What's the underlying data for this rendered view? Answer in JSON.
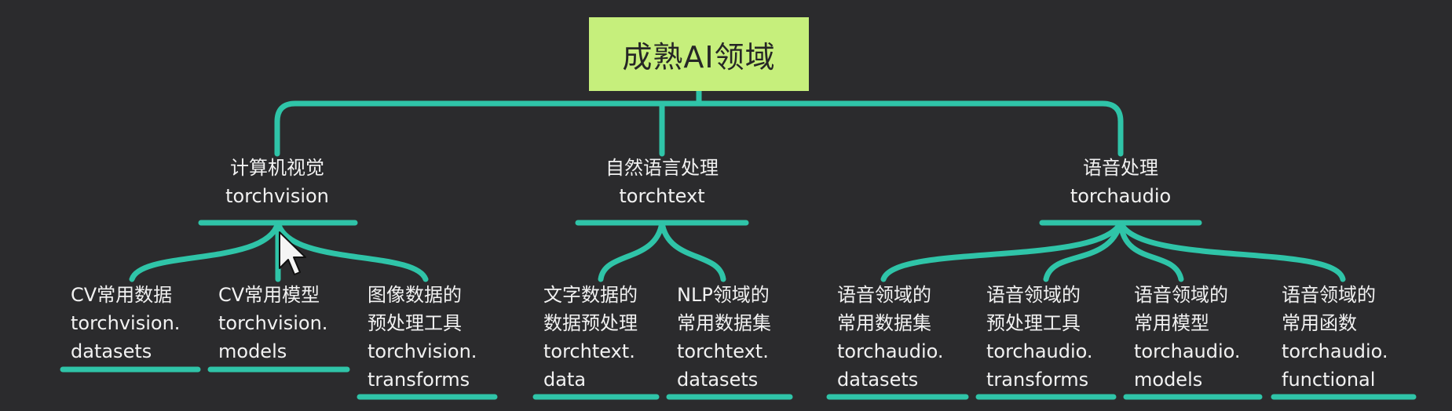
{
  "diagram": {
    "root": {
      "label": "成熟AI领域"
    },
    "categories": [
      {
        "title": "计算机视觉",
        "package": "torchvision",
        "children": [
          {
            "lines": [
              "CV常用数据",
              "torchvision.",
              "datasets"
            ]
          },
          {
            "lines": [
              "CV常用模型",
              "torchvision.",
              "models"
            ]
          },
          {
            "lines": [
              "图像数据的",
              "预处理工具",
              "torchvision.",
              "transforms"
            ]
          }
        ]
      },
      {
        "title": "自然语言处理",
        "package": "torchtext",
        "children": [
          {
            "lines": [
              "文字数据的",
              "数据预处理",
              "torchtext.",
              "data"
            ]
          },
          {
            "lines": [
              "NLP领域的",
              "常用数据集",
              "torchtext.",
              "datasets"
            ]
          }
        ]
      },
      {
        "title": "语音处理",
        "package": "torchaudio",
        "children": [
          {
            "lines": [
              "语音领域的",
              "常用数据集",
              "torchaudio.",
              "datasets"
            ]
          },
          {
            "lines": [
              "语音领域的",
              "预处理工具",
              "torchaudio.",
              "transforms"
            ]
          },
          {
            "lines": [
              "语音领域的",
              "常用模型",
              "torchaudio.",
              "models"
            ]
          },
          {
            "lines": [
              "语音领域的",
              "常用函数",
              "torchaudio.",
              "functional"
            ]
          }
        ]
      }
    ]
  },
  "colors": {
    "background": "#2b2b2d",
    "connector": "#2fc4a8",
    "root_fill": "#c6ef7c",
    "root_text": "#262626",
    "text": "#f2f2f2"
  },
  "icons": {
    "cursor": "mouse-pointer-icon"
  }
}
